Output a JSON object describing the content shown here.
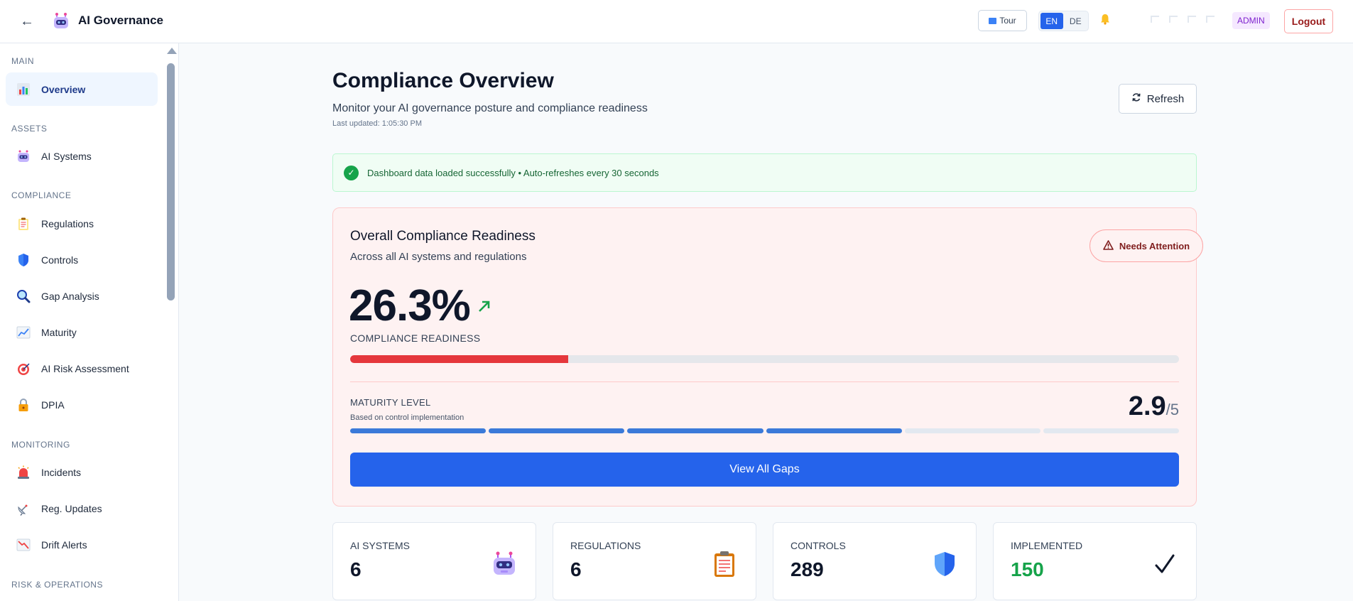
{
  "header": {
    "back_label": "←",
    "title": "AI Governance",
    "tour_label": "Tour",
    "languages": [
      "EN",
      "DE"
    ],
    "active_language": "EN",
    "bell_icon": "bell-icon",
    "role": "ADMIN",
    "logout_label": "Logout"
  },
  "sidebar": {
    "sections": [
      {
        "label": "MAIN",
        "items": [
          {
            "label": "Overview",
            "icon": "chart-icon",
            "active": true
          }
        ]
      },
      {
        "label": "ASSETS",
        "items": [
          {
            "label": "AI Systems",
            "icon": "robot-icon"
          }
        ]
      },
      {
        "label": "COMPLIANCE",
        "items": [
          {
            "label": "Regulations",
            "icon": "clipboard-icon"
          },
          {
            "label": "Controls",
            "icon": "shield-icon"
          },
          {
            "label": "Gap Analysis",
            "icon": "magnifier-icon"
          },
          {
            "label": "Maturity",
            "icon": "line-chart-icon"
          },
          {
            "label": "AI Risk Assessment",
            "icon": "target-icon"
          },
          {
            "label": "DPIA",
            "icon": "lock-icon"
          }
        ]
      },
      {
        "label": "MONITORING",
        "items": [
          {
            "label": "Incidents",
            "icon": "siren-icon"
          },
          {
            "label": "Reg. Updates",
            "icon": "satellite-icon"
          },
          {
            "label": "Drift Alerts",
            "icon": "down-chart-icon"
          }
        ]
      },
      {
        "label": "RISK & OPERATIONS",
        "items": []
      }
    ]
  },
  "main": {
    "title": "Compliance Overview",
    "subtitle": "Monitor your AI governance posture and compliance readiness",
    "last_updated": "Last updated: 1:05:30 PM",
    "refresh_label": "Refresh",
    "alert_text": "Dashboard data loaded successfully • Auto-refreshes every 30 seconds",
    "readiness": {
      "title": "Overall Compliance Readiness",
      "subtitle": "Across all AI systems and regulations",
      "status_label": "Needs Attention",
      "percent_text": "26.3%",
      "percent_value": 26.3,
      "label": "COMPLIANCE READINESS",
      "bar_color": "#e5373c",
      "maturity_label": "MATURITY LEVEL",
      "maturity_sub": "Based on control implementation",
      "maturity_value": "2.9",
      "maturity_max": "/5",
      "maturity_segments_filled": 4,
      "maturity_segments_total": 6,
      "cta_label": "View All Gaps"
    },
    "stats": [
      {
        "label": "AI SYSTEMS",
        "value": "6",
        "icon": "robot-icon"
      },
      {
        "label": "REGULATIONS",
        "value": "6",
        "icon": "clipboard-icon"
      },
      {
        "label": "CONTROLS",
        "value": "289",
        "icon": "shield-icon"
      },
      {
        "label": "IMPLEMENTED",
        "value": "150",
        "icon": "checkmark-icon",
        "accent": "#16a34a"
      }
    ]
  }
}
